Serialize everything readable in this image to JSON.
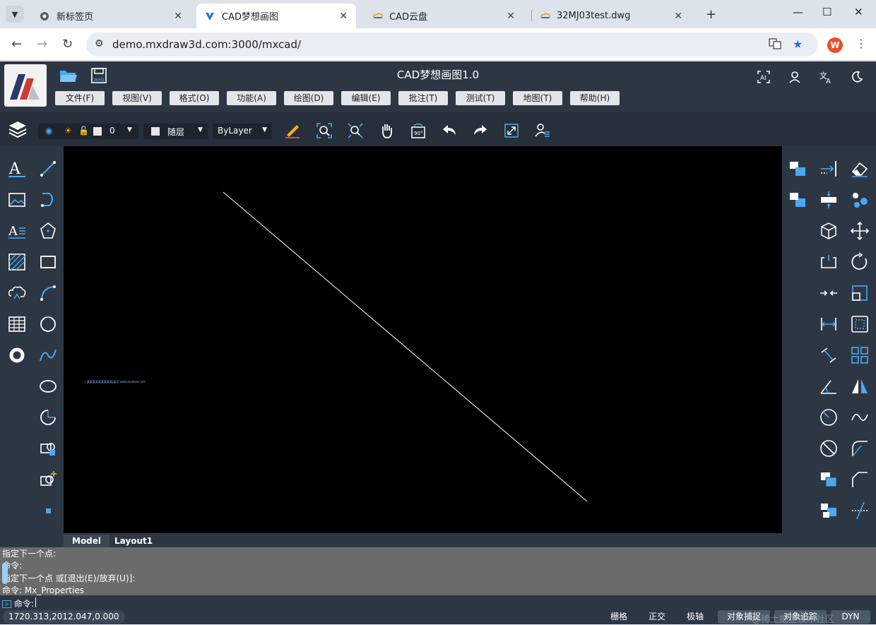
{
  "browser": {
    "tabs": [
      {
        "title": "新标签页",
        "close": "✕"
      },
      {
        "title": "CAD梦想画图",
        "close": "✕"
      },
      {
        "title": "CAD云盘",
        "close": "✕"
      },
      {
        "title": "32MJ03test.dwg",
        "close": "✕"
      }
    ],
    "new_tab": "+",
    "url": "demo.mxdraw3d.com:3000/mxcad/",
    "profile_initial": "W"
  },
  "app": {
    "title": "CAD梦想画图1.0",
    "menu": [
      "文件(F)",
      "视图(V)",
      "格式(O)",
      "功能(A)",
      "绘图(D)",
      "编辑(E)",
      "批注(T)",
      "测试(T)",
      "地图(T)",
      "帮助(H)"
    ],
    "layer_value": "0",
    "color_value": "随层",
    "linetype_value": "ByLayer"
  },
  "canvas": {
    "tiny_text": "( 某某某某某某某某某)某号 www.mxdraw.com"
  },
  "layout_tabs": [
    "Model",
    "Layout1"
  ],
  "command_log": [
    "指定下一个点:",
    "命令:",
    "指定下一个点 或[退出(E)/放弃(U)]:",
    "命令: Mx_Properties"
  ],
  "command_prompt": "命令:",
  "status": {
    "coords": "1720.313,2012.047,0.000",
    "buttons": [
      "栅格",
      "正交",
      "极轴",
      "对象捕捉",
      "对象追踪",
      "DYN"
    ],
    "watermark": "@稀土掘金技术社区"
  },
  "colors": {
    "app_bg": "#2d3744",
    "canvas_bg": "#000000",
    "accent": "#4aa8f0"
  }
}
